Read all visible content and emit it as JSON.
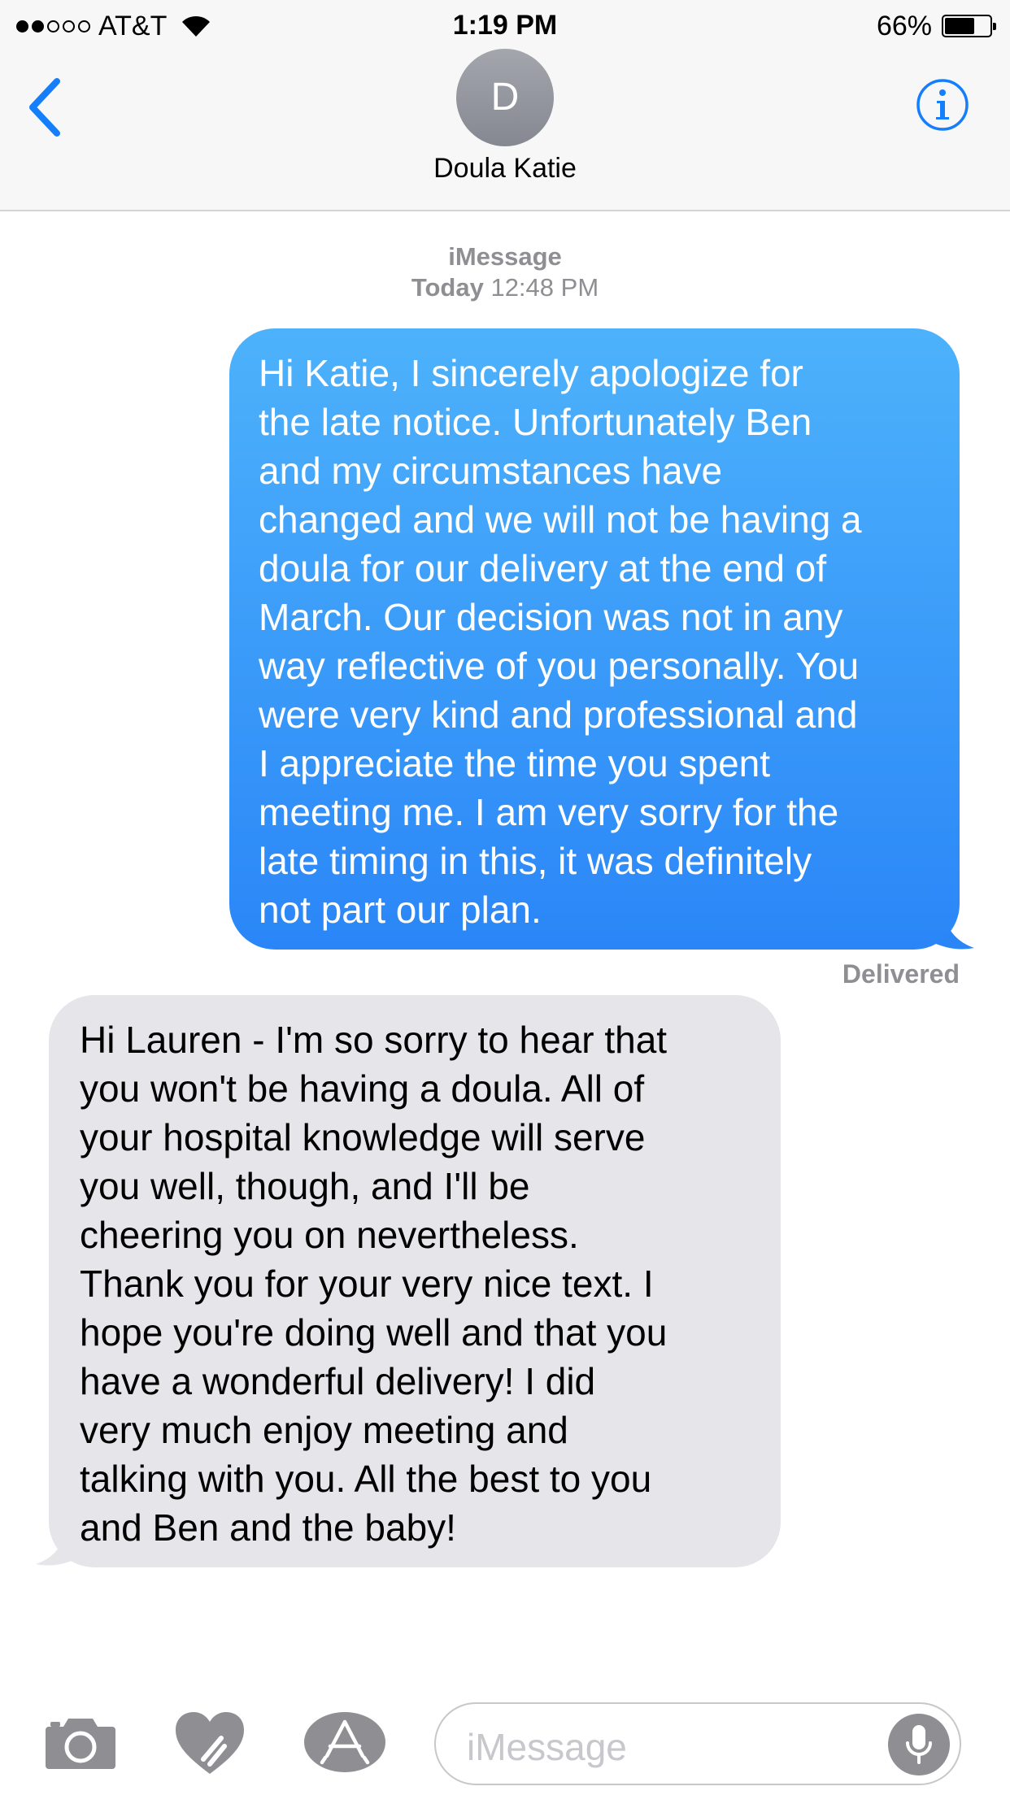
{
  "status_bar": {
    "carrier": "AT&T",
    "time": "1:19 PM",
    "battery_text": "66%",
    "battery_level": 0.66,
    "signal_bars": 2,
    "signal_total": 5
  },
  "header": {
    "avatar_initial": "D",
    "contact_name": "Doula Katie",
    "icons": {
      "back": "chevron-left-icon",
      "info": "info-icon"
    },
    "accent_color": "#147efb"
  },
  "conversation": {
    "service": "iMessage",
    "date_label": "Today",
    "time_label": "12:48 PM",
    "messages": [
      {
        "direction": "sent",
        "lines": [
          "Hi Katie, I sincerely apologize for",
          "the late notice. Unfortunately Ben",
          "and my circumstances have",
          "changed and we will not be having a",
          "doula for our delivery at the end of",
          "March. Our decision was not in any",
          "way reflective of you personally. You",
          "were very kind and professional and",
          "I appreciate the time you spent",
          "meeting me. I am very sorry for the",
          "late timing in this, it was definitely",
          "not part our plan."
        ],
        "status": "Delivered",
        "color": "#2a86f7"
      },
      {
        "direction": "received",
        "lines": [
          "Hi Lauren - I'm so sorry to hear that",
          "you won't be having a doula.  All of",
          "your hospital knowledge will serve",
          "you well, though, and I'll be",
          "cheering you on nevertheless.",
          "Thank you for your very nice text.  I",
          "hope you're doing well and that you",
          "have a wonderful delivery!  I did",
          "very much enjoy meeting and",
          "talking with you.  All the best to you",
          "and Ben and the baby!"
        ],
        "color": "#e5e5ea"
      }
    ]
  },
  "input_bar": {
    "placeholder": "iMessage",
    "icons": [
      "camera-icon",
      "digital-touch-heart-icon",
      "app-store-icon",
      "microphone-icon"
    ]
  }
}
